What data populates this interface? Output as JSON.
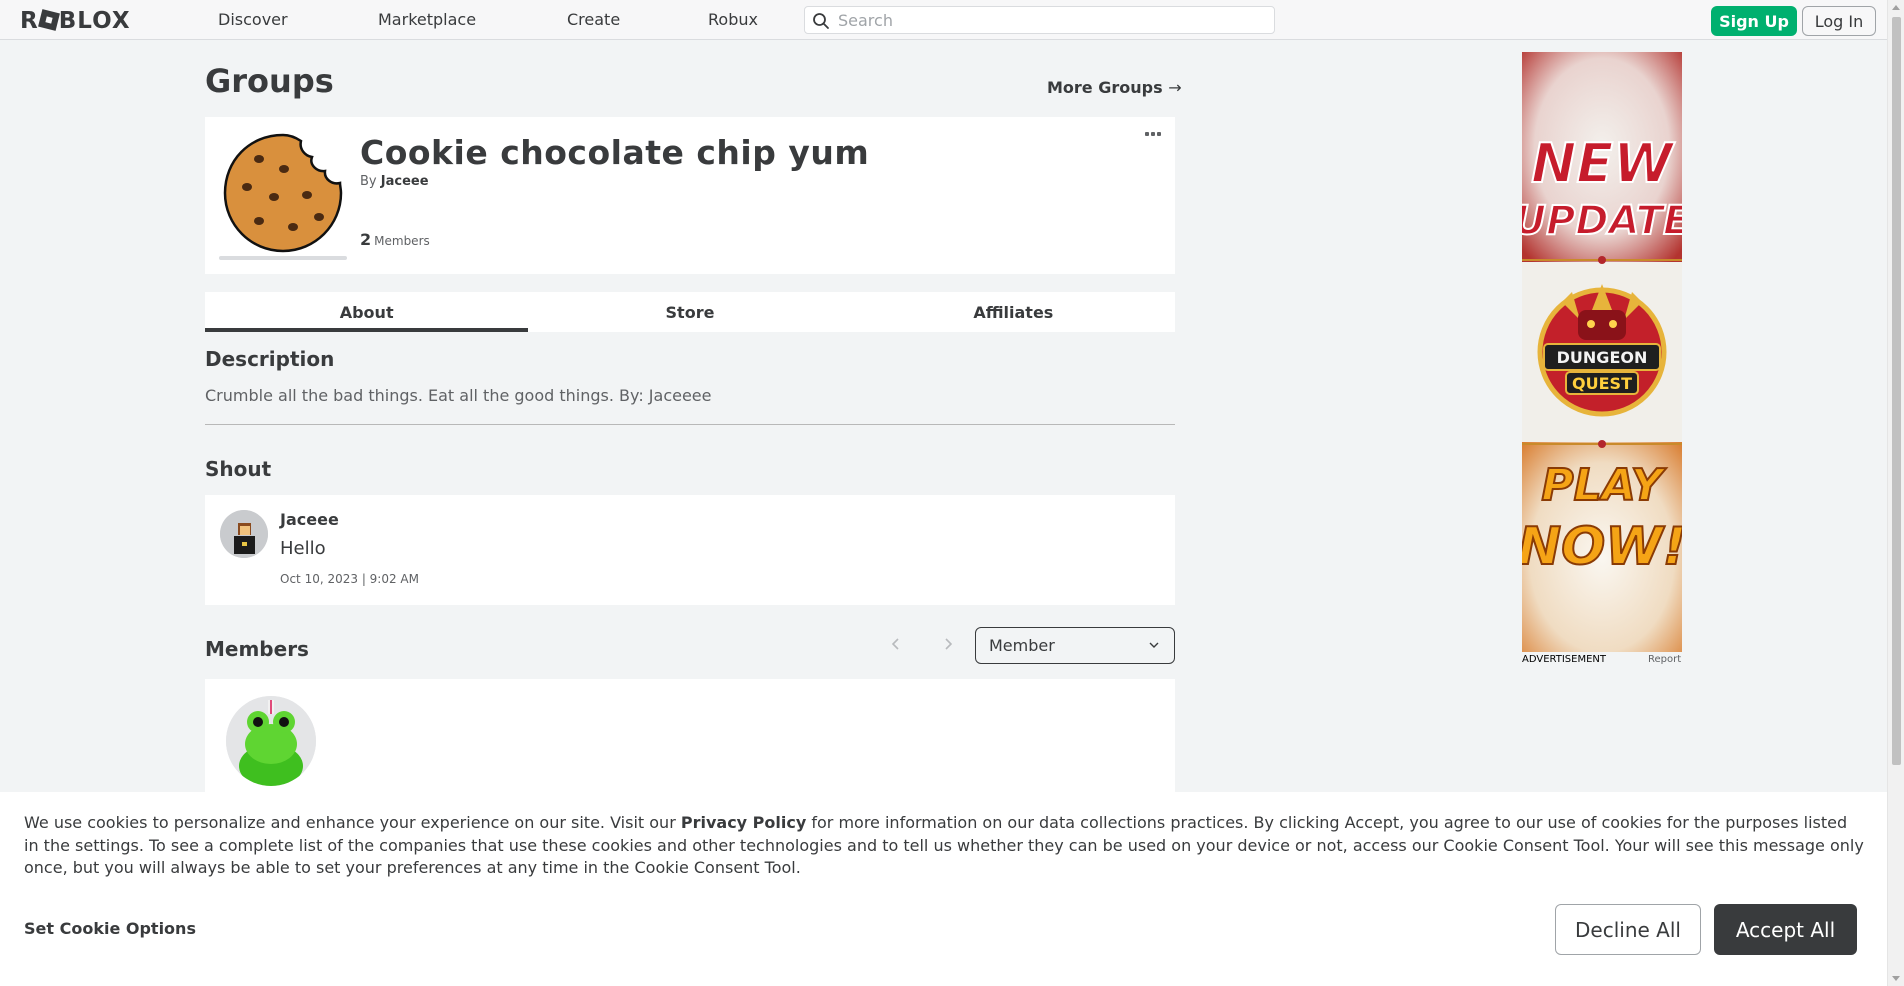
{
  "nav": {
    "logo": "ROBLOX",
    "links": [
      "Discover",
      "Marketplace",
      "Create",
      "Robux"
    ],
    "search_placeholder": "Search",
    "signup_label": "Sign Up",
    "login_label": "Log In"
  },
  "page": {
    "title": "Groups",
    "more_groups": "More Groups",
    "more_groups_arrow": "→"
  },
  "group": {
    "name": "Cookie chocolate chip yum",
    "by_prefix": "By",
    "owner": "Jaceee",
    "member_count": "2",
    "member_label": "Members"
  },
  "tabs": [
    "About",
    "Store",
    "Affiliates"
  ],
  "description": {
    "heading": "Description",
    "text": "Crumble all the bad things. Eat all the good things. By: Jaceeee"
  },
  "shout": {
    "heading": "Shout",
    "user": "Jaceee",
    "body": "Hello",
    "time": "Oct 10, 2023 | 9:02 AM"
  },
  "members": {
    "heading": "Members",
    "role_selected": "Member"
  },
  "ad": {
    "line1": "NEW",
    "line2": "UPDATE",
    "logo_line1": "DUNGEON",
    "logo_line2": "QUEST",
    "line3": "PLAY",
    "line4": "NOW!",
    "label": "ADVERTISEMENT",
    "report": "Report"
  },
  "cookie": {
    "text_before": "We use cookies to personalize and enhance your experience on our site. Visit our ",
    "privacy_link": "Privacy Policy",
    "text_after": " for more information on our data collections practices. By clicking Accept, you agree to our use of cookies for the purposes listed in the settings. To see a complete list of the companies that use these cookies and other technologies and to tell us whether they can be used on your device or not, access our Cookie Consent Tool. Your will see this message only once, but you will always be able to set your preferences at any time in the Cookie Consent Tool.",
    "options_label": "Set Cookie Options",
    "decline_label": "Decline All",
    "accept_label": "Accept All"
  },
  "colors": {
    "accent_green": "#00b06f",
    "text_dark": "#393b3d",
    "page_bg": "#f2f4f5"
  }
}
